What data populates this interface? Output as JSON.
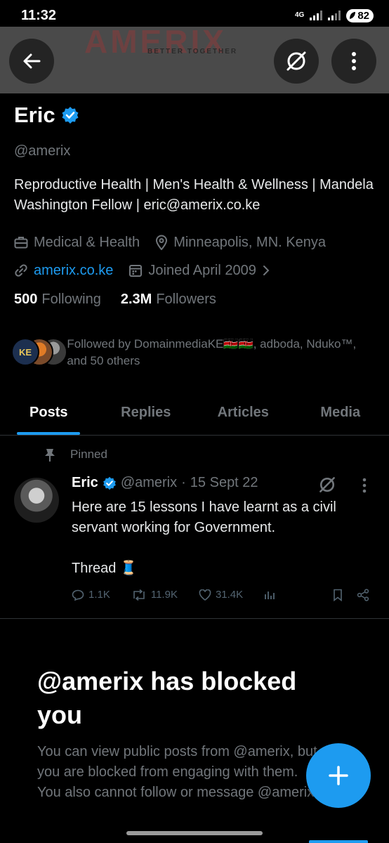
{
  "status_bar": {
    "time": "11:32",
    "network": "4G",
    "battery": "82"
  },
  "header": {
    "banner_text": "AMERIX",
    "banner_subtext": "BETTER TOGETHER"
  },
  "profile": {
    "name": "Eric",
    "handle": "@amerix",
    "bio": "Reproductive Health | Men's Health & Wellness | Mandela Washington Fellow | eric@amerix.co.ke",
    "category": "Medical & Health",
    "location": "Minneapolis, MN. Kenya",
    "website": "amerix.co.ke",
    "joined": "Joined April 2009",
    "following_count": "500",
    "following_label": "Following",
    "followers_count": "2.3M",
    "followers_label": "Followers",
    "followed_by": "Followed by DomainmediaKE🇰🇪🇰🇪, adboda, Nduko™, and 50 others",
    "followed_avatar_text": "KE"
  },
  "tabs": [
    {
      "label": "Posts",
      "active": true
    },
    {
      "label": "Replies",
      "active": false
    },
    {
      "label": "Articles",
      "active": false
    },
    {
      "label": "Media",
      "active": false
    }
  ],
  "pinned_post": {
    "pinned_label": "Pinned",
    "author_name": "Eric",
    "author_handle": "@amerix",
    "date": "15 Sept 22",
    "separator": "·",
    "text_line1": "Here are 15 lessons I have learnt as a civil servant working for Government.",
    "text_line2": "Thread 🧵",
    "replies": "1.1K",
    "reposts": "11.9K",
    "likes": "31.4K"
  },
  "blocked": {
    "title": "@amerix has blocked you",
    "message": "You can view public posts from @amerix, but you are blocked from engaging with them. You also cannot follow or message @amerix."
  },
  "colors": {
    "accent": "#1d9bf0",
    "secondary_text": "#71767b",
    "background": "#000000"
  }
}
